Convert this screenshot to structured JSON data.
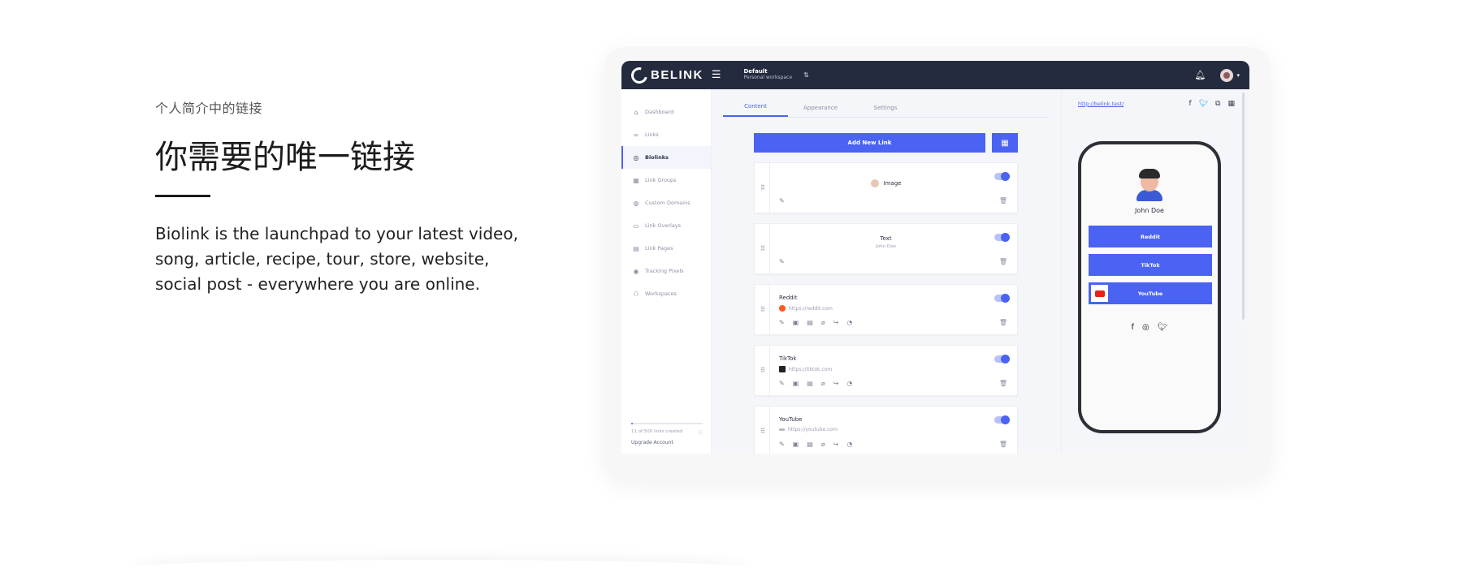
{
  "hero": {
    "eyebrow": "个人简介中的链接",
    "headline": "你需要的唯一链接",
    "blurb": "Biolink is the launchpad to your latest video, song, article, recipe, tour, store, website, social post - everywhere you are online."
  },
  "app": {
    "brand": "BELINK",
    "workspace_name": "Default",
    "workspace_sub": "Personal workspace",
    "sidebar": {
      "items": [
        {
          "label": "Dashboard",
          "icon": "home-icon",
          "glyph": "⌂"
        },
        {
          "label": "Links",
          "icon": "link-icon",
          "glyph": "∞"
        },
        {
          "label": "Biolinks",
          "icon": "instagram-icon",
          "glyph": "◎"
        },
        {
          "label": "Link Groups",
          "icon": "grid-icon",
          "glyph": "▦"
        },
        {
          "label": "Custom Domains",
          "icon": "globe-icon",
          "glyph": "◍"
        },
        {
          "label": "Link Overlays",
          "icon": "overlay-icon",
          "glyph": "▭"
        },
        {
          "label": "Link Pages",
          "icon": "pages-icon",
          "glyph": "▤"
        },
        {
          "label": "Tracking Pixels",
          "icon": "pin-icon",
          "glyph": "◉"
        },
        {
          "label": "Workspaces",
          "icon": "users-icon",
          "glyph": "⚇"
        }
      ],
      "active_index": 2,
      "quota": "11 of 500 links created",
      "quota_fraction": 0.022,
      "upgrade": "Upgrade Account"
    },
    "tabs": [
      "Content",
      "Appearance",
      "Settings"
    ],
    "active_tab": "Content",
    "add_button": "Add New Link",
    "cards": [
      {
        "title": "Image",
        "kind": "image"
      },
      {
        "title": "Text",
        "sub": "John Doe",
        "kind": "text"
      },
      {
        "title": "Reddit",
        "url": "https://reddit.com",
        "kind": "link"
      },
      {
        "title": "TikTok",
        "url": "https://tiktok.com",
        "kind": "link"
      },
      {
        "title": "YouTube",
        "url": "https://youtube.com",
        "kind": "link"
      }
    ],
    "preview": {
      "url": "http://belink.test/",
      "name": "John Doe",
      "buttons": [
        "Reddit",
        "TikTok",
        "YouTube"
      ]
    }
  },
  "colors": {
    "accent": "#4a63f2",
    "topbar": "#252b3f"
  }
}
